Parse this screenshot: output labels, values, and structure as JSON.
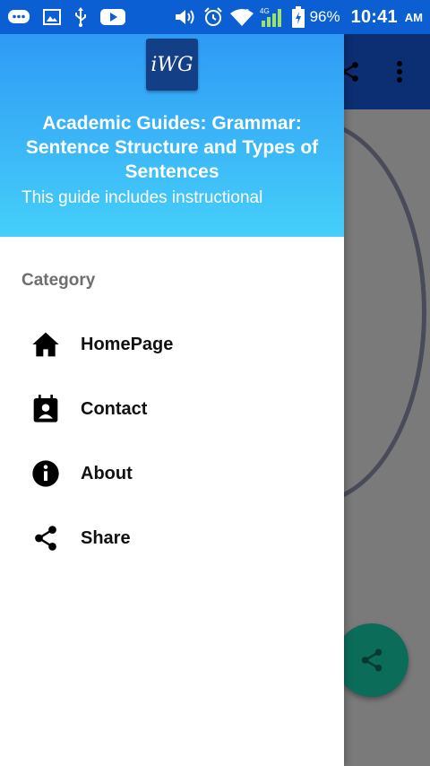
{
  "status_bar": {
    "battery": "96%",
    "time": "10:41",
    "ampm": "AM",
    "icons": [
      "message-icon",
      "image-icon",
      "usb-icon",
      "youtube-icon",
      "volume-icon",
      "alarm-icon",
      "wifi-icon",
      "signal-icon",
      "battery-charging-icon"
    ]
  },
  "drawer": {
    "logo_text": "iWG",
    "title": "Academic Guides: Grammar: Sentence Structure and Types of Sentences",
    "subtitle": "This guide includes instructional",
    "category_label": "Category",
    "items": [
      {
        "label": "HomePage",
        "icon": "home-icon"
      },
      {
        "label": "Contact",
        "icon": "contact-icon"
      },
      {
        "label": "About",
        "icon": "info-icon"
      },
      {
        "label": "Share",
        "icon": "share-icon"
      }
    ]
  },
  "colors": {
    "status_bar": "#0b5fd3",
    "header_top": "#2f9af5",
    "header_bottom": "#45cff9",
    "toolbar": "#0c2e72",
    "fab": "#0b6c5a"
  }
}
